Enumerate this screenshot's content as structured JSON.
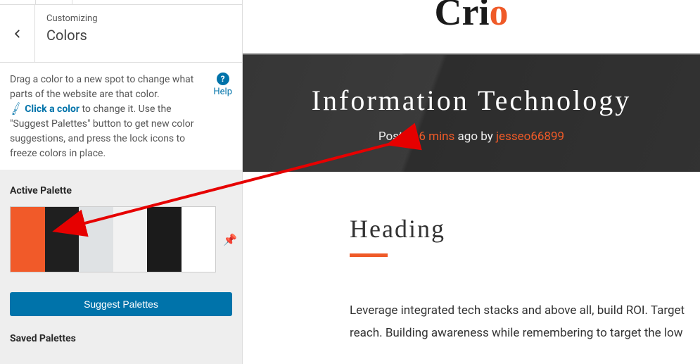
{
  "sidebar": {
    "customizing_label": "Customizing",
    "section_title": "Colors",
    "description": {
      "line1": "Drag a color to a new spot to change what parts of the website are that color.",
      "click_color": "Click a color",
      "line2": " to change it. Use the \"Suggest Palettes\" button to get new color suggestions, and press the lock icons to freeze colors in place."
    },
    "help_label": "Help",
    "active_palette_label": "Active Palette",
    "palette_colors": [
      "#f15a29",
      "#1f1f1f",
      "#dfe2e4",
      "#f2f2f2",
      "#1b1b1b",
      "#ffffff"
    ],
    "suggest_button": "Suggest Palettes",
    "saved_palettes_label": "Saved Palettes"
  },
  "preview": {
    "logo_text": "Cri",
    "logo_accent": "o",
    "hero_title": "Information Technology",
    "meta_posted": "Posted ",
    "meta_time": "6 mins",
    "meta_ago_by": " ago by ",
    "meta_author": "jesseo66899",
    "heading": "Heading",
    "body": "Leverage integrated tech stacks and above all, build ROI. Target reach. Building awareness while remembering to target the low"
  }
}
